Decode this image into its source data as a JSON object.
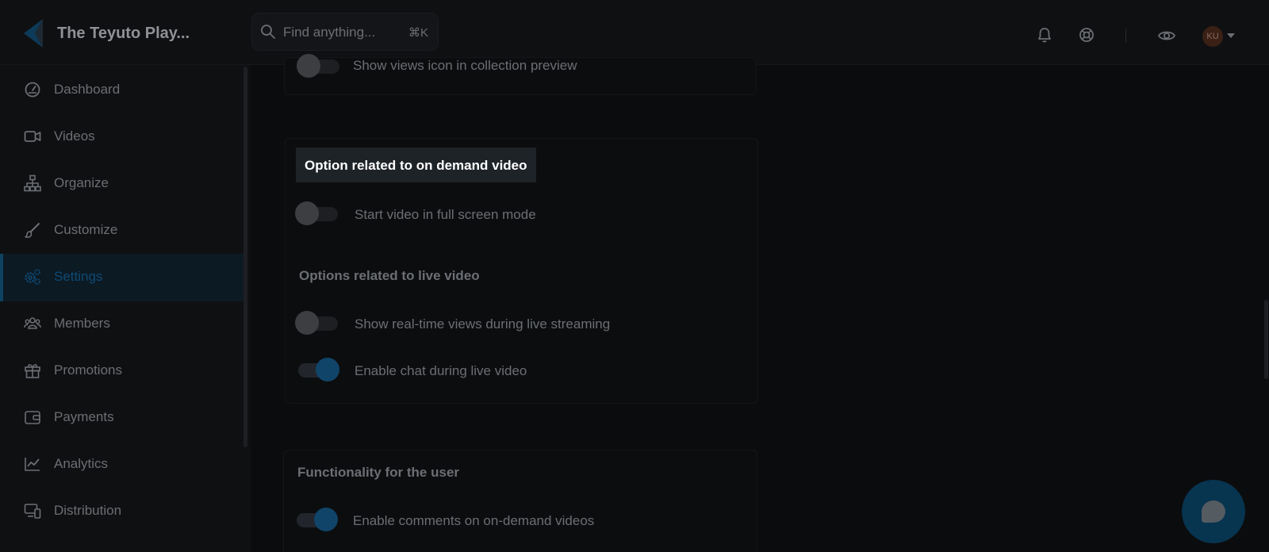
{
  "header": {
    "app_title": "The Teyuto Play...",
    "search_placeholder": "Find anything...",
    "search_shortcut": "⌘K",
    "avatar_initials": "KU"
  },
  "sidebar": {
    "items": [
      {
        "label": "Dashboard",
        "icon": "gauge-icon"
      },
      {
        "label": "Videos",
        "icon": "video-camera-icon"
      },
      {
        "label": "Organize",
        "icon": "sitemap-icon"
      },
      {
        "label": "Customize",
        "icon": "paintbrush-icon"
      },
      {
        "label": "Settings",
        "icon": "gears-icon",
        "active": true
      },
      {
        "label": "Members",
        "icon": "users-icon"
      },
      {
        "label": "Promotions",
        "icon": "gift-icon"
      },
      {
        "label": "Payments",
        "icon": "wallet-icon"
      },
      {
        "label": "Analytics",
        "icon": "chart-line-icon"
      },
      {
        "label": "Distribution",
        "icon": "devices-icon"
      }
    ]
  },
  "main": {
    "collection": {
      "options": [
        {
          "label": "Show views icon in collection preview",
          "enabled": false
        }
      ]
    },
    "on_demand": {
      "title": "Option related to on demand video",
      "options": [
        {
          "label": "Start video in full screen mode",
          "enabled": false
        }
      ]
    },
    "live": {
      "title": "Options related to live video",
      "options": [
        {
          "label": "Show real-time views during live streaming",
          "enabled": false
        },
        {
          "label": "Enable chat during live video",
          "enabled": true
        }
      ]
    },
    "user": {
      "title": "Functionality for the user",
      "options": [
        {
          "label": "Enable comments on on-demand videos",
          "enabled": true
        }
      ]
    }
  },
  "colors": {
    "background": "#0b0c0e",
    "sidebar_bg": "#0f1012",
    "accent": "#104468",
    "active_text": "#0e4a74",
    "highlight_bg": "#1e2328"
  }
}
